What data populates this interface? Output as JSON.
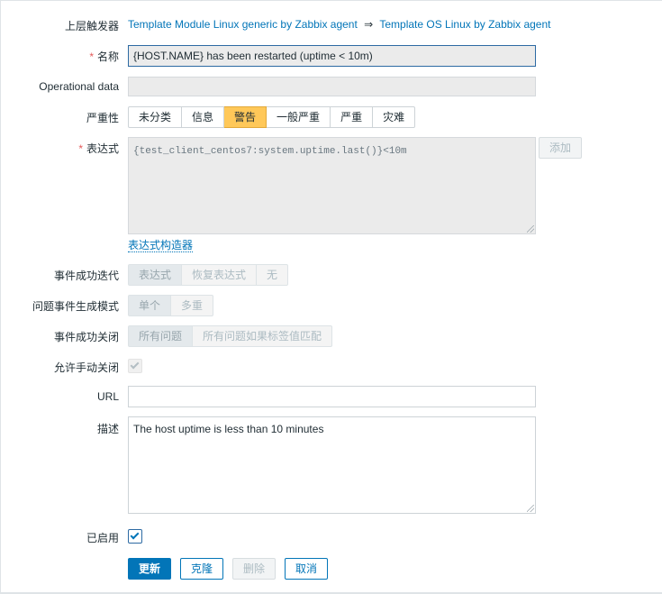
{
  "parent_triggers": {
    "label": "上层触发器",
    "link1": "Template Module Linux generic by Zabbix agent",
    "arrow": "⇒",
    "link2": "Template OS Linux by Zabbix agent"
  },
  "name": {
    "required": "*",
    "label": "名称",
    "value": "{HOST.NAME} has been restarted (uptime < 10m)"
  },
  "operational_data": {
    "label": "Operational data",
    "value": ""
  },
  "severity": {
    "label": "严重性",
    "options": [
      "未分类",
      "信息",
      "警告",
      "一般严重",
      "严重",
      "灾难"
    ],
    "selected": "警告",
    "selected_color": "#ffc859"
  },
  "expression": {
    "required": "*",
    "label": "表达式",
    "value": "{test_client_centos7:system.uptime.last()}<10m",
    "add_button": "添加",
    "constructor_link": "表达式构造器"
  },
  "ok_event_generation": {
    "label": "事件成功迭代",
    "options": [
      "表达式",
      "恢复表达式",
      "无"
    ],
    "selected": "表达式"
  },
  "problem_event_mode": {
    "label": "问题事件生成模式",
    "options": [
      "单个",
      "多重"
    ],
    "selected": "单个"
  },
  "ok_event_closes": {
    "label": "事件成功关闭",
    "options": [
      "所有问题",
      "所有问题如果标签值匹配"
    ],
    "selected": "所有问题"
  },
  "allow_manual_close": {
    "label": "允许手动关闭",
    "checked": true
  },
  "url": {
    "label": "URL",
    "value": ""
  },
  "description": {
    "label": "描述",
    "value": "The host uptime is less than 10 minutes"
  },
  "enabled": {
    "label": "已启用",
    "checked": true
  },
  "buttons": {
    "update": "更新",
    "clone": "克隆",
    "delete": "删除",
    "cancel": "取消"
  },
  "colors": {
    "accent": "#0275b8",
    "warning": "#ffc859",
    "required": "#e45959"
  }
}
